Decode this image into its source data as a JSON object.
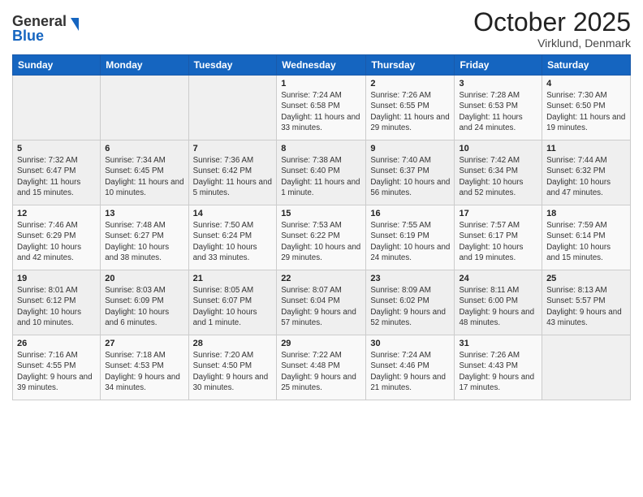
{
  "header": {
    "logo_general": "General",
    "logo_blue": "Blue",
    "title": "October 2025",
    "subtitle": "Virklund, Denmark"
  },
  "days": [
    "Sunday",
    "Monday",
    "Tuesday",
    "Wednesday",
    "Thursday",
    "Friday",
    "Saturday"
  ],
  "weeks": [
    [
      {
        "num": "",
        "sunrise": "",
        "sunset": "",
        "daylight": ""
      },
      {
        "num": "",
        "sunrise": "",
        "sunset": "",
        "daylight": ""
      },
      {
        "num": "",
        "sunrise": "",
        "sunset": "",
        "daylight": ""
      },
      {
        "num": "1",
        "sunrise": "Sunrise: 7:24 AM",
        "sunset": "Sunset: 6:58 PM",
        "daylight": "Daylight: 11 hours and 33 minutes."
      },
      {
        "num": "2",
        "sunrise": "Sunrise: 7:26 AM",
        "sunset": "Sunset: 6:55 PM",
        "daylight": "Daylight: 11 hours and 29 minutes."
      },
      {
        "num": "3",
        "sunrise": "Sunrise: 7:28 AM",
        "sunset": "Sunset: 6:53 PM",
        "daylight": "Daylight: 11 hours and 24 minutes."
      },
      {
        "num": "4",
        "sunrise": "Sunrise: 7:30 AM",
        "sunset": "Sunset: 6:50 PM",
        "daylight": "Daylight: 11 hours and 19 minutes."
      }
    ],
    [
      {
        "num": "5",
        "sunrise": "Sunrise: 7:32 AM",
        "sunset": "Sunset: 6:47 PM",
        "daylight": "Daylight: 11 hours and 15 minutes."
      },
      {
        "num": "6",
        "sunrise": "Sunrise: 7:34 AM",
        "sunset": "Sunset: 6:45 PM",
        "daylight": "Daylight: 11 hours and 10 minutes."
      },
      {
        "num": "7",
        "sunrise": "Sunrise: 7:36 AM",
        "sunset": "Sunset: 6:42 PM",
        "daylight": "Daylight: 11 hours and 5 minutes."
      },
      {
        "num": "8",
        "sunrise": "Sunrise: 7:38 AM",
        "sunset": "Sunset: 6:40 PM",
        "daylight": "Daylight: 11 hours and 1 minute."
      },
      {
        "num": "9",
        "sunrise": "Sunrise: 7:40 AM",
        "sunset": "Sunset: 6:37 PM",
        "daylight": "Daylight: 10 hours and 56 minutes."
      },
      {
        "num": "10",
        "sunrise": "Sunrise: 7:42 AM",
        "sunset": "Sunset: 6:34 PM",
        "daylight": "Daylight: 10 hours and 52 minutes."
      },
      {
        "num": "11",
        "sunrise": "Sunrise: 7:44 AM",
        "sunset": "Sunset: 6:32 PM",
        "daylight": "Daylight: 10 hours and 47 minutes."
      }
    ],
    [
      {
        "num": "12",
        "sunrise": "Sunrise: 7:46 AM",
        "sunset": "Sunset: 6:29 PM",
        "daylight": "Daylight: 10 hours and 42 minutes."
      },
      {
        "num": "13",
        "sunrise": "Sunrise: 7:48 AM",
        "sunset": "Sunset: 6:27 PM",
        "daylight": "Daylight: 10 hours and 38 minutes."
      },
      {
        "num": "14",
        "sunrise": "Sunrise: 7:50 AM",
        "sunset": "Sunset: 6:24 PM",
        "daylight": "Daylight: 10 hours and 33 minutes."
      },
      {
        "num": "15",
        "sunrise": "Sunrise: 7:53 AM",
        "sunset": "Sunset: 6:22 PM",
        "daylight": "Daylight: 10 hours and 29 minutes."
      },
      {
        "num": "16",
        "sunrise": "Sunrise: 7:55 AM",
        "sunset": "Sunset: 6:19 PM",
        "daylight": "Daylight: 10 hours and 24 minutes."
      },
      {
        "num": "17",
        "sunrise": "Sunrise: 7:57 AM",
        "sunset": "Sunset: 6:17 PM",
        "daylight": "Daylight: 10 hours and 19 minutes."
      },
      {
        "num": "18",
        "sunrise": "Sunrise: 7:59 AM",
        "sunset": "Sunset: 6:14 PM",
        "daylight": "Daylight: 10 hours and 15 minutes."
      }
    ],
    [
      {
        "num": "19",
        "sunrise": "Sunrise: 8:01 AM",
        "sunset": "Sunset: 6:12 PM",
        "daylight": "Daylight: 10 hours and 10 minutes."
      },
      {
        "num": "20",
        "sunrise": "Sunrise: 8:03 AM",
        "sunset": "Sunset: 6:09 PM",
        "daylight": "Daylight: 10 hours and 6 minutes."
      },
      {
        "num": "21",
        "sunrise": "Sunrise: 8:05 AM",
        "sunset": "Sunset: 6:07 PM",
        "daylight": "Daylight: 10 hours and 1 minute."
      },
      {
        "num": "22",
        "sunrise": "Sunrise: 8:07 AM",
        "sunset": "Sunset: 6:04 PM",
        "daylight": "Daylight: 9 hours and 57 minutes."
      },
      {
        "num": "23",
        "sunrise": "Sunrise: 8:09 AM",
        "sunset": "Sunset: 6:02 PM",
        "daylight": "Daylight: 9 hours and 52 minutes."
      },
      {
        "num": "24",
        "sunrise": "Sunrise: 8:11 AM",
        "sunset": "Sunset: 6:00 PM",
        "daylight": "Daylight: 9 hours and 48 minutes."
      },
      {
        "num": "25",
        "sunrise": "Sunrise: 8:13 AM",
        "sunset": "Sunset: 5:57 PM",
        "daylight": "Daylight: 9 hours and 43 minutes."
      }
    ],
    [
      {
        "num": "26",
        "sunrise": "Sunrise: 7:16 AM",
        "sunset": "Sunset: 4:55 PM",
        "daylight": "Daylight: 9 hours and 39 minutes."
      },
      {
        "num": "27",
        "sunrise": "Sunrise: 7:18 AM",
        "sunset": "Sunset: 4:53 PM",
        "daylight": "Daylight: 9 hours and 34 minutes."
      },
      {
        "num": "28",
        "sunrise": "Sunrise: 7:20 AM",
        "sunset": "Sunset: 4:50 PM",
        "daylight": "Daylight: 9 hours and 30 minutes."
      },
      {
        "num": "29",
        "sunrise": "Sunrise: 7:22 AM",
        "sunset": "Sunset: 4:48 PM",
        "daylight": "Daylight: 9 hours and 25 minutes."
      },
      {
        "num": "30",
        "sunrise": "Sunrise: 7:24 AM",
        "sunset": "Sunset: 4:46 PM",
        "daylight": "Daylight: 9 hours and 21 minutes."
      },
      {
        "num": "31",
        "sunrise": "Sunrise: 7:26 AM",
        "sunset": "Sunset: 4:43 PM",
        "daylight": "Daylight: 9 hours and 17 minutes."
      },
      {
        "num": "",
        "sunrise": "",
        "sunset": "",
        "daylight": ""
      }
    ]
  ]
}
